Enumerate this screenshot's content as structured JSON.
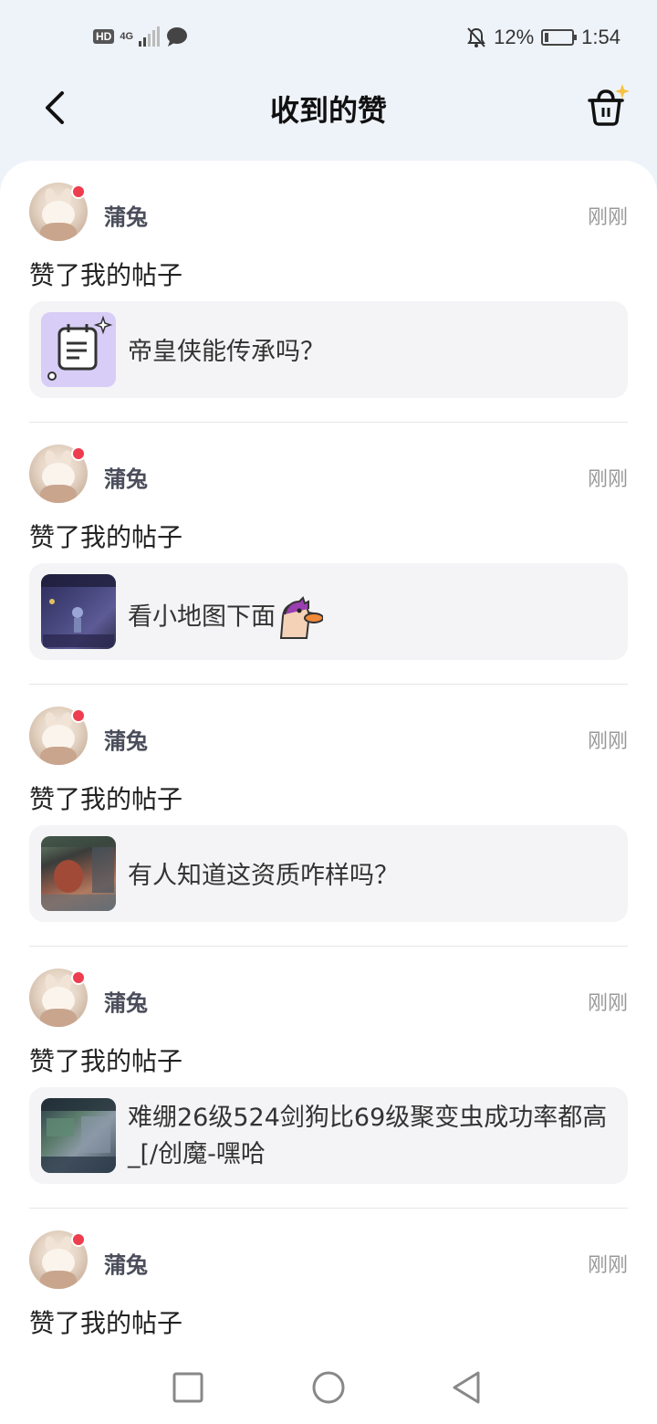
{
  "status_bar": {
    "left_icons": [
      "hd-icon",
      "4g-icon",
      "signal-icon",
      "message-icon"
    ],
    "hd": "HD",
    "network": "4G",
    "battery": "12%",
    "time": "1:54"
  },
  "header": {
    "title": "收到的赞",
    "back_icon": "back-chevron-icon",
    "right_icon": "basket-icon"
  },
  "items": [
    {
      "username": "蒲兔",
      "time": "刚刚",
      "action": "赞了我的帖子",
      "post_text": "帝皇侠能传承吗？",
      "thumb": "note"
    },
    {
      "username": "蒲兔",
      "time": "刚刚",
      "action": "赞了我的帖子",
      "post_text": "看小地图下面",
      "thumb": "game-screenshot"
    },
    {
      "username": "蒲兔",
      "time": "刚刚",
      "action": "赞了我的帖子",
      "post_text": "有人知道这资质咋样吗？",
      "thumb": "game-screenshot"
    },
    {
      "username": "蒲兔",
      "time": "刚刚",
      "action": "赞了我的帖子",
      "post_text": "难绷26级524剑狗比69级聚变虫成功率都高_[/创魔-嘿哈",
      "thumb": "game-screenshot"
    },
    {
      "username": "蒲兔",
      "time": "刚刚",
      "action": "赞了我的帖子"
    }
  ],
  "nav_bar": {
    "icons": [
      "recent-apps-icon",
      "home-icon",
      "back-triangle-icon"
    ]
  },
  "colors": {
    "background": "#eef3f9",
    "card": "#ffffff",
    "post_bg": "#f4f4f6",
    "unread_dot": "#ee3d4f",
    "username": "#4a4d5a",
    "time": "#999999"
  }
}
